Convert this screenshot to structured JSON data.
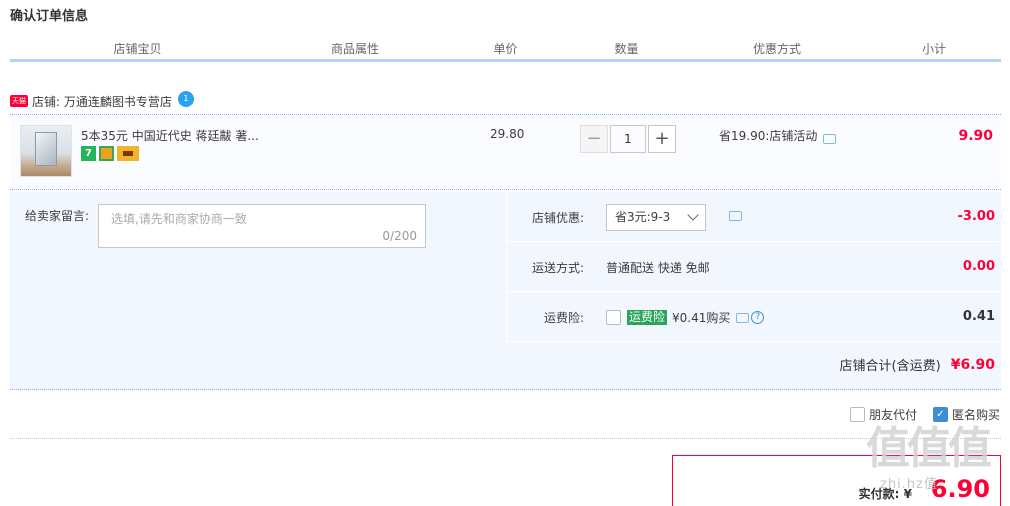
{
  "page": {
    "title": "确认订单信息"
  },
  "columns": [
    "店铺宝贝",
    "商品属性",
    "单价",
    "数量",
    "优惠方式",
    "小计"
  ],
  "shop": {
    "badge": "天猫",
    "label": "店铺: 万通连麟图书专营店",
    "chat_badge": "1"
  },
  "item": {
    "title": "5本35元 中国近代史 蒋廷黻 著...",
    "price": "29.80",
    "quantity": "1",
    "minus": "−",
    "plus": "+",
    "discount": "省19.90:店铺活动",
    "subtotal": "9.90",
    "badges": {
      "seven": "7"
    }
  },
  "message": {
    "label": "给卖家留言:",
    "placeholder": "选填,请先和商家协商一致",
    "count": "0/200"
  },
  "shop_discount": {
    "label": "店铺优惠:",
    "selected": "省3元:9-3",
    "value": "-3.00"
  },
  "shipping": {
    "label": "运送方式:",
    "text": "普通配送 快递 免邮",
    "value": "0.00"
  },
  "insurance": {
    "label": "运费险:",
    "tag": "运费险",
    "price": "¥0.41购买",
    "value": "0.41",
    "help": "?"
  },
  "shop_total": {
    "label": "店铺合计(含运费)",
    "amount": "¥6.90"
  },
  "options": {
    "friend_pay": "朋友代付",
    "anonymous": "匿名购买",
    "check": "✓"
  },
  "payment": {
    "label": "实付款: ¥",
    "amount": "6.90"
  },
  "watermark": {
    "logo": "值值值",
    "sub": "zhi.hz值"
  },
  "colors": {
    "accent": "#ff0036",
    "header_line": "#b2d1ff",
    "panel_bg": "#f2f7ff"
  }
}
